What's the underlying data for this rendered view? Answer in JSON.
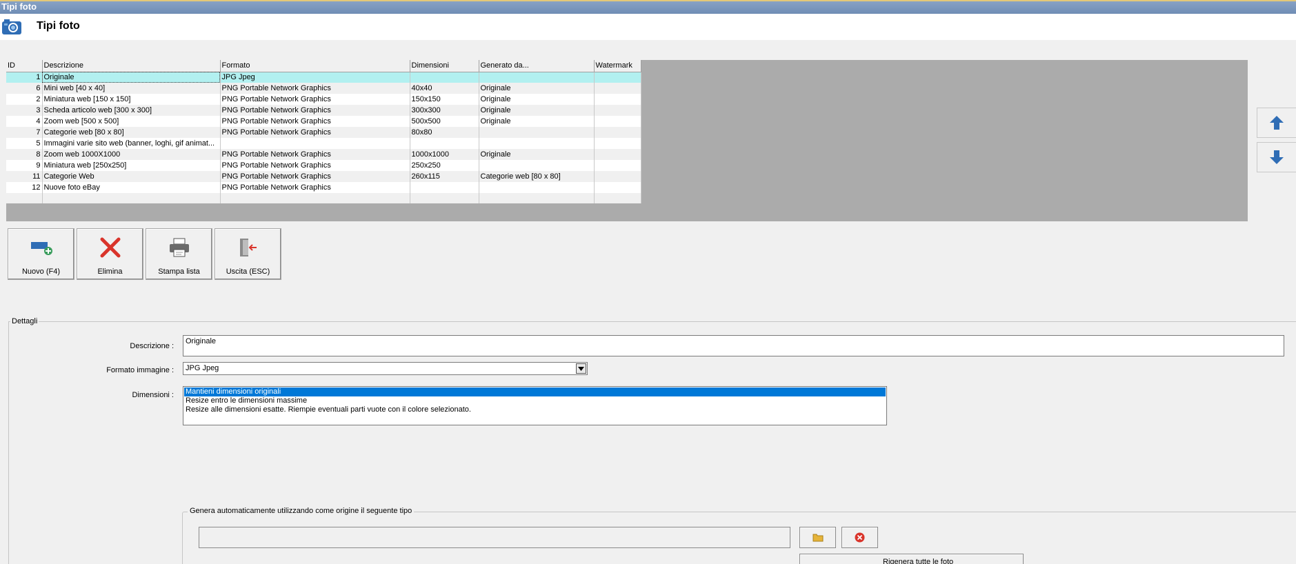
{
  "window": {
    "title": "Tipi foto"
  },
  "header": {
    "title": "Tipi foto",
    "icon": "camera-icon"
  },
  "grid": {
    "columns": [
      "ID",
      "Descrizione",
      "Formato",
      "Dimensioni",
      "Generato da...",
      "Watermark"
    ],
    "rows": [
      {
        "id": "1",
        "descrizione": "Originale",
        "formato": "JPG Jpeg",
        "dimensioni": "",
        "generato": "",
        "watermark": ""
      },
      {
        "id": "6",
        "descrizione": "Mini web [40 x 40]",
        "formato": "PNG Portable Network Graphics",
        "dimensioni": "40x40",
        "generato": "Originale",
        "watermark": ""
      },
      {
        "id": "2",
        "descrizione": "Miniatura web [150 x 150]",
        "formato": "PNG Portable Network Graphics",
        "dimensioni": "150x150",
        "generato": "Originale",
        "watermark": ""
      },
      {
        "id": "3",
        "descrizione": "Scheda articolo web [300 x 300]",
        "formato": "PNG Portable Network Graphics",
        "dimensioni": "300x300",
        "generato": "Originale",
        "watermark": ""
      },
      {
        "id": "4",
        "descrizione": "Zoom web [500 x 500]",
        "formato": "PNG Portable Network Graphics",
        "dimensioni": "500x500",
        "generato": "Originale",
        "watermark": ""
      },
      {
        "id": "7",
        "descrizione": "Categorie web [80 x 80]",
        "formato": "PNG Portable Network Graphics",
        "dimensioni": "80x80",
        "generato": "",
        "watermark": ""
      },
      {
        "id": "5",
        "descrizione": "Immagini varie sito web (banner, loghi, gif animat...",
        "formato": "",
        "dimensioni": "",
        "generato": "",
        "watermark": ""
      },
      {
        "id": "8",
        "descrizione": "Zoom web 1000X1000",
        "formato": "PNG Portable Network Graphics",
        "dimensioni": "1000x1000",
        "generato": "Originale",
        "watermark": ""
      },
      {
        "id": "9",
        "descrizione": "Miniatura web  [250x250]",
        "formato": "PNG Portable Network Graphics",
        "dimensioni": "250x250",
        "generato": "",
        "watermark": ""
      },
      {
        "id": "11",
        "descrizione": "Categorie Web",
        "formato": "PNG Portable Network Graphics",
        "dimensioni": "260x115",
        "generato": "Categorie web [80 x 80]",
        "watermark": ""
      },
      {
        "id": "12",
        "descrizione": "Nuove foto eBay",
        "formato": "PNG Portable Network Graphics",
        "dimensioni": "",
        "generato": "",
        "watermark": ""
      }
    ],
    "selected_row": 0
  },
  "toolbar": {
    "new_label": "Nuovo (F4)",
    "delete_label": "Elimina",
    "print_label": "Stampa lista",
    "exit_label": "Uscita (ESC)"
  },
  "details": {
    "legend": "Dettagli",
    "descrizione_label": "Descrizione :",
    "descrizione_value": "Originale",
    "formato_label": "Formato immagine :",
    "formato_value": "JPG Jpeg",
    "dimensioni_label": "Dimensioni :",
    "dimensioni_options": [
      "Mantieni dimensioni originali",
      "Resize entro le dimensioni massime",
      "Resize alle dimensioni esatte. Riempie eventuali parti vuote con il colore selezionato."
    ],
    "dimensioni_selected": 0
  },
  "autogen": {
    "legend": "Genera automaticamente utilizzando come origine il seguente tipo",
    "source_value": "",
    "regen_label": "Rigenera tutte le foto"
  },
  "colors": {
    "selected_row": "#b2f0f0",
    "accent": "#0078d7",
    "arrow": "#2f6db5",
    "delete": "#d9342b"
  }
}
